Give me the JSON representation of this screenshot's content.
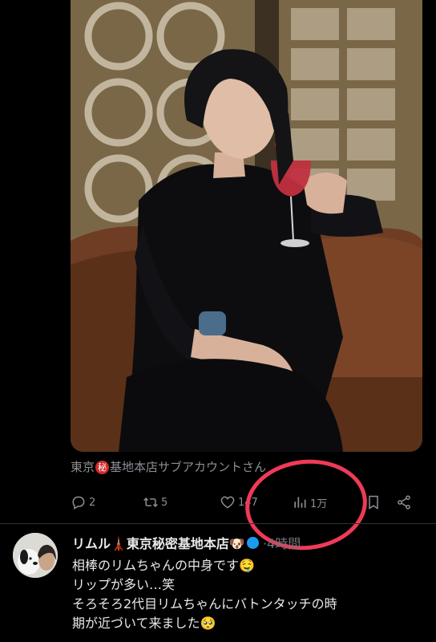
{
  "tweet": {
    "caption_prefix": "東京",
    "caption_badge": "秘",
    "caption_suffix": "基地本店サブアカウントさん",
    "replies": "2",
    "retweets": "5",
    "likes": "147",
    "views": "1万"
  },
  "next_post": {
    "author_name": "リムル🗼東京秘密基地本店🐶",
    "separator": "·",
    "time_ago": "4時間",
    "lines": [
      "相棒のリムちゃんの中身です🤤",
      "リップが多い…笑",
      "そろそろ2代目リムちゃんにバトンタッチの時",
      "期が近づいて来ました🥺"
    ]
  },
  "colors": {
    "background": "#000000",
    "muted_text": "#8b8f94",
    "annotation_circle": "#ef3a58",
    "verified_badge": "#1d9bf0"
  },
  "icons": [
    "reply-icon",
    "retweet-icon",
    "like-icon",
    "views-icon",
    "bookmark-icon",
    "share-icon"
  ]
}
